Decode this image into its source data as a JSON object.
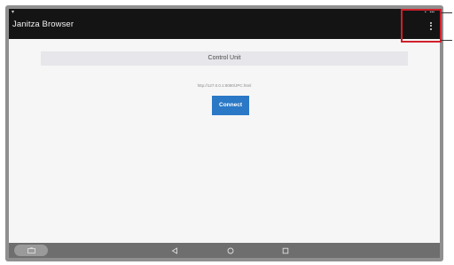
{
  "app_bar": {
    "title": "Janitza Browser",
    "status_left_icon": "signal-icon",
    "status_right": [
      "▪",
      "▪▪▪"
    ],
    "menu_icon": "overflow-menu-icon"
  },
  "content": {
    "header_label": "Control Unit",
    "url_text": "http://127.0.0.1:8080/JPC.html",
    "connect_label": "Connect"
  },
  "navbar": {
    "left_icon": "screenshot-icon",
    "back_icon": "back-triangle-icon",
    "home_icon": "home-circle-icon",
    "recents_icon": "recents-square-icon"
  },
  "colors": {
    "app_bar_bg": "#141414",
    "screen_bg": "#f6f6f6",
    "button_bg": "#2b78c6",
    "highlight": "#d0202a",
    "navbar_bg": "#6e6e6e"
  }
}
